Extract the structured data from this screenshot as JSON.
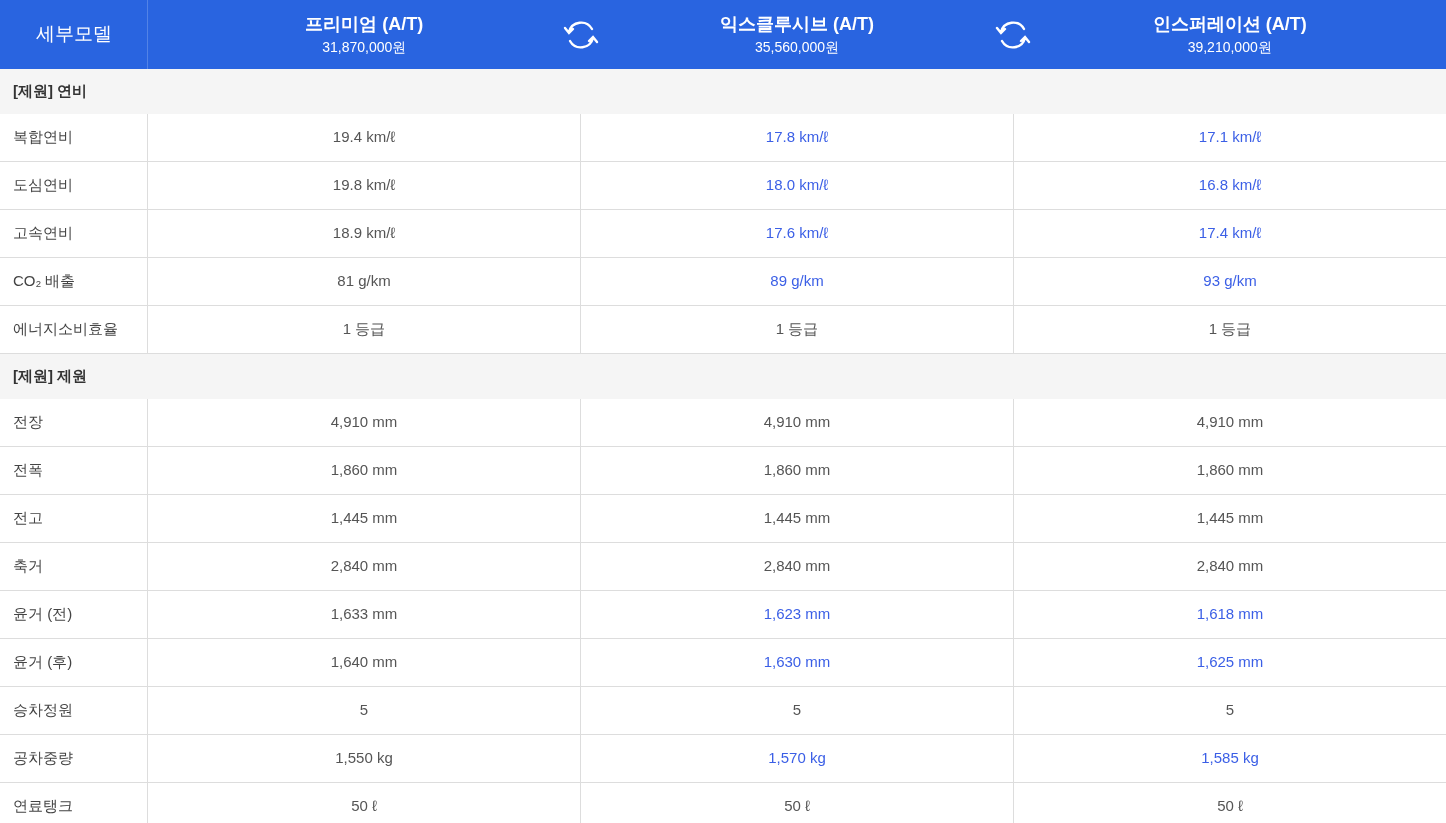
{
  "header": {
    "label": "세부모델",
    "models": [
      {
        "name": "프리미엄 (A/T)",
        "price": "31,870,000원"
      },
      {
        "name": "익스클루시브 (A/T)",
        "price": "35,560,000원"
      },
      {
        "name": "인스퍼레이션 (A/T)",
        "price": "39,210,000원"
      }
    ]
  },
  "sections": [
    {
      "title": "[제원] 연비",
      "rows": [
        {
          "label": "복합연비",
          "values": [
            {
              "text": "19.4 km/ℓ",
              "differs": false
            },
            {
              "text": "17.8 km/ℓ",
              "differs": true
            },
            {
              "text": "17.1 km/ℓ",
              "differs": true
            }
          ]
        },
        {
          "label": "도심연비",
          "values": [
            {
              "text": "19.8 km/ℓ",
              "differs": false
            },
            {
              "text": "18.0 km/ℓ",
              "differs": true
            },
            {
              "text": "16.8 km/ℓ",
              "differs": true
            }
          ]
        },
        {
          "label": "고속연비",
          "values": [
            {
              "text": "18.9 km/ℓ",
              "differs": false
            },
            {
              "text": "17.6 km/ℓ",
              "differs": true
            },
            {
              "text": "17.4 km/ℓ",
              "differs": true
            }
          ]
        },
        {
          "label": "CO₂ 배출",
          "values": [
            {
              "text": "81 g/km",
              "differs": false
            },
            {
              "text": "89 g/km",
              "differs": true
            },
            {
              "text": "93 g/km",
              "differs": true
            }
          ]
        },
        {
          "label": "에너지소비효율",
          "values": [
            {
              "text": "1 등급",
              "differs": false
            },
            {
              "text": "1 등급",
              "differs": false
            },
            {
              "text": "1 등급",
              "differs": false
            }
          ]
        }
      ]
    },
    {
      "title": "[제원] 제원",
      "rows": [
        {
          "label": "전장",
          "values": [
            {
              "text": "4,910 mm",
              "differs": false
            },
            {
              "text": "4,910 mm",
              "differs": false
            },
            {
              "text": "4,910 mm",
              "differs": false
            }
          ]
        },
        {
          "label": "전폭",
          "values": [
            {
              "text": "1,860 mm",
              "differs": false
            },
            {
              "text": "1,860 mm",
              "differs": false
            },
            {
              "text": "1,860 mm",
              "differs": false
            }
          ]
        },
        {
          "label": "전고",
          "values": [
            {
              "text": "1,445 mm",
              "differs": false
            },
            {
              "text": "1,445 mm",
              "differs": false
            },
            {
              "text": "1,445 mm",
              "differs": false
            }
          ]
        },
        {
          "label": "축거",
          "values": [
            {
              "text": "2,840 mm",
              "differs": false
            },
            {
              "text": "2,840 mm",
              "differs": false
            },
            {
              "text": "2,840 mm",
              "differs": false
            }
          ]
        },
        {
          "label": "윤거 (전)",
          "values": [
            {
              "text": "1,633 mm",
              "differs": false
            },
            {
              "text": "1,623 mm",
              "differs": true
            },
            {
              "text": "1,618 mm",
              "differs": true
            }
          ]
        },
        {
          "label": "윤거 (후)",
          "values": [
            {
              "text": "1,640 mm",
              "differs": false
            },
            {
              "text": "1,630 mm",
              "differs": true
            },
            {
              "text": "1,625 mm",
              "differs": true
            }
          ]
        },
        {
          "label": "승차정원",
          "values": [
            {
              "text": "5",
              "differs": false
            },
            {
              "text": "5",
              "differs": false
            },
            {
              "text": "5",
              "differs": false
            }
          ]
        },
        {
          "label": "공차중량",
          "values": [
            {
              "text": "1,550 kg",
              "differs": false
            },
            {
              "text": "1,570 kg",
              "differs": true
            },
            {
              "text": "1,585 kg",
              "differs": true
            }
          ]
        },
        {
          "label": "연료탱크",
          "values": [
            {
              "text": "50 ℓ",
              "differs": false
            },
            {
              "text": "50 ℓ",
              "differs": false
            },
            {
              "text": "50 ℓ",
              "differs": false
            }
          ]
        }
      ]
    }
  ]
}
